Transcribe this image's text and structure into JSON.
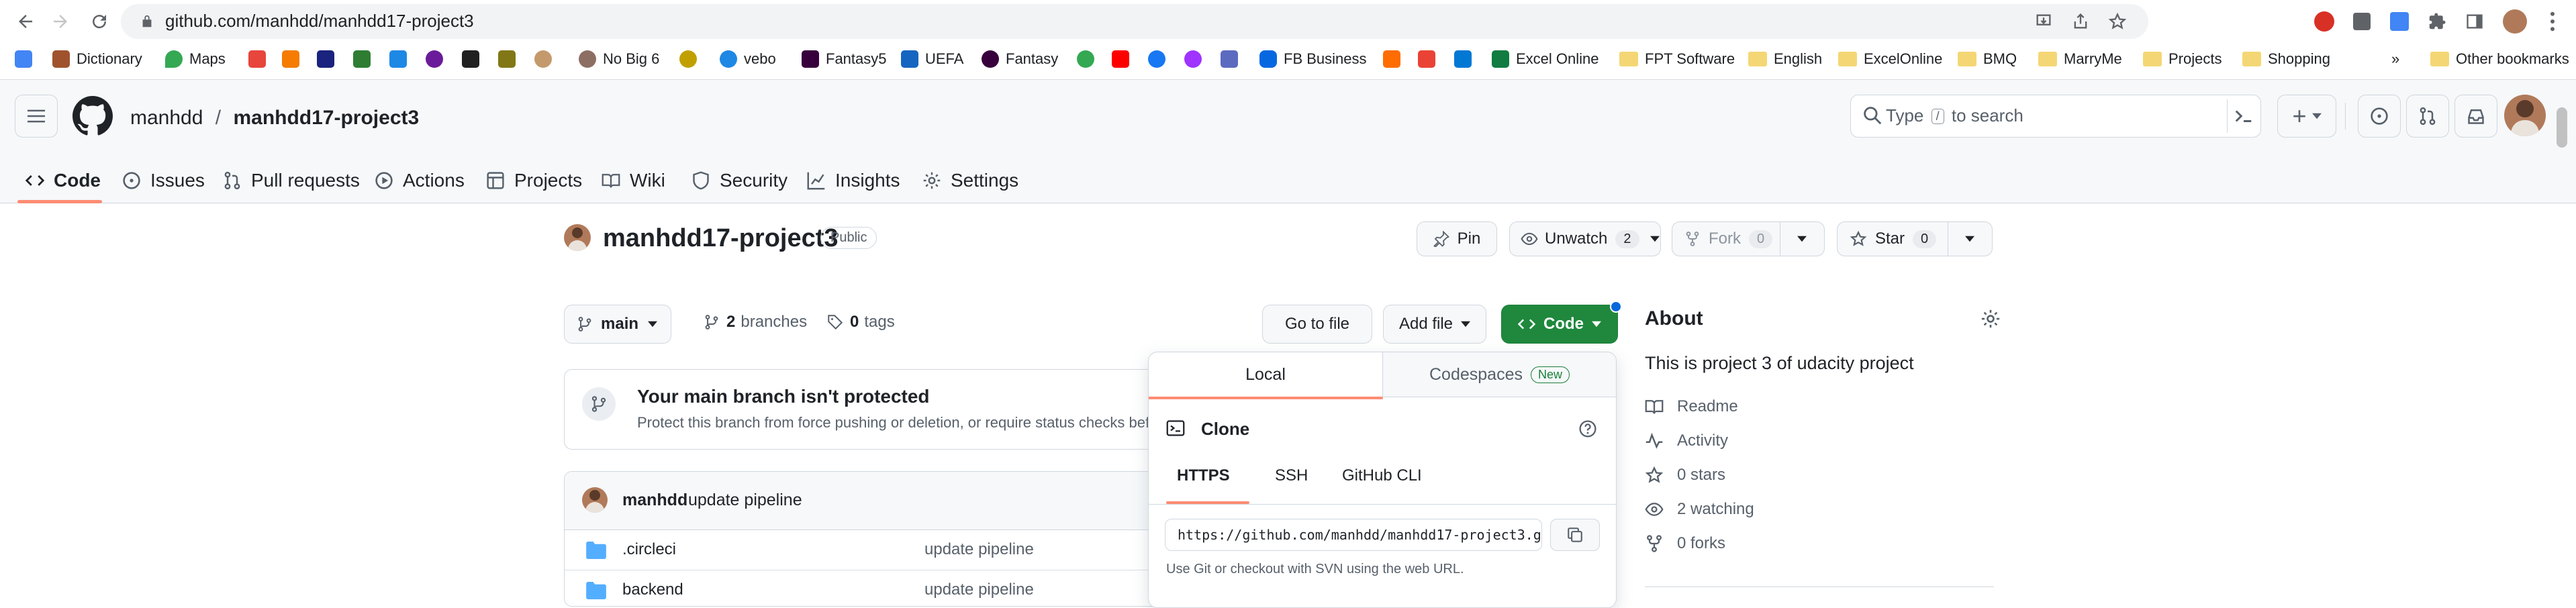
{
  "browser": {
    "url": "github.com/manhdd/manhdd17-project3",
    "bookmarks": [
      {
        "label": "Dictionary"
      },
      {
        "label": "Maps"
      },
      {
        "label": "No Big 6"
      },
      {
        "label": "vebo"
      },
      {
        "label": "Fantasy5"
      },
      {
        "label": "UEFA"
      },
      {
        "label": "Fantasy"
      },
      {
        "label": "FB Business"
      },
      {
        "label": "Excel Online"
      },
      {
        "label": "FPT Software"
      },
      {
        "label": "English"
      },
      {
        "label": "ExcelOnline"
      },
      {
        "label": "BMQ"
      },
      {
        "label": "MarryMe"
      },
      {
        "label": "Projects"
      },
      {
        "label": "Shopping"
      },
      {
        "label": "»"
      },
      {
        "label": "Other bookmarks"
      }
    ]
  },
  "header": {
    "owner": "manhdd",
    "separator": "/",
    "repo": "manhdd17-project3",
    "search_type": "Type",
    "search_key": "/",
    "search_rest": "to search",
    "plus": "+"
  },
  "tabs": [
    {
      "label": "Code"
    },
    {
      "label": "Issues"
    },
    {
      "label": "Pull requests"
    },
    {
      "label": "Actions"
    },
    {
      "label": "Projects"
    },
    {
      "label": "Wiki"
    },
    {
      "label": "Security"
    },
    {
      "label": "Insights"
    },
    {
      "label": "Settings"
    }
  ],
  "repo": {
    "name": "manhdd17-project3",
    "visibility": "Public",
    "pin": "Pin",
    "unwatch": "Unwatch",
    "watch_count": "2",
    "fork": "Fork",
    "fork_count": "0",
    "star": "Star",
    "star_count": "0"
  },
  "toolbar": {
    "branch": "main",
    "branches_count": "2",
    "branches_label": "branches",
    "tags_count": "0",
    "tags_label": "tags",
    "go_to_file": "Go to file",
    "add_file": "Add file",
    "code": "Code"
  },
  "protect": {
    "title": "Your main branch isn't protected",
    "desc": "Protect this branch from force pushing or deletion, or require status checks before"
  },
  "commit": {
    "author": "manhdd",
    "message": "update pipeline"
  },
  "files": [
    {
      "name": ".circleci",
      "message": "update pipeline"
    },
    {
      "name": "backend",
      "message": "update pipeline"
    }
  ],
  "code_panel": {
    "local": "Local",
    "codespaces": "Codespaces",
    "new_badge": "New",
    "clone": "Clone",
    "https": "HTTPS",
    "ssh": "SSH",
    "cli": "GitHub CLI",
    "clone_url": "https://github.com/manhdd/manhdd17-project3.g",
    "hint": "Use Git or checkout with SVN using the web URL."
  },
  "about": {
    "title": "About",
    "description": "This is project 3 of udacity project",
    "readme": "Readme",
    "activity": "Activity",
    "stars": "0 stars",
    "watching": "2 watching",
    "forks": "0 forks"
  },
  "colors": {
    "accent_green": "#1f883d",
    "tab_underline": "#fd8c73",
    "link_blue": "#0969da",
    "folder_blue": "#54aeff"
  }
}
